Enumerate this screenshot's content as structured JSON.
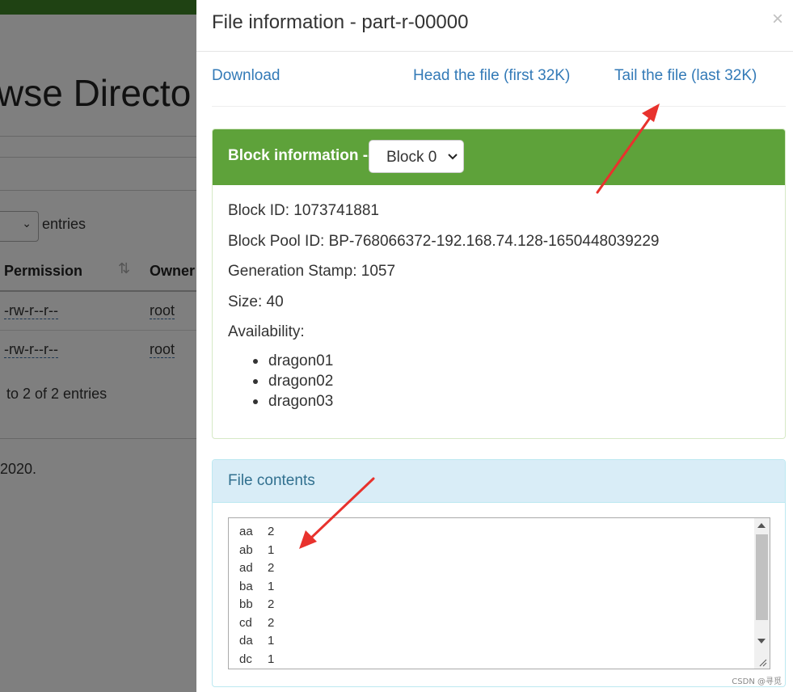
{
  "background": {
    "page_title_fragment": "wse Directo",
    "entries_label": "entries",
    "columns": [
      "Permission",
      "Owner"
    ],
    "rows": [
      {
        "permission": "-rw-r--r--",
        "owner": "root"
      },
      {
        "permission": "-rw-r--r--",
        "owner": "root"
      }
    ],
    "table_info": "to 2 of 2 entries",
    "footer_fragment": "2020."
  },
  "modal": {
    "title": "File information - part-r-00000",
    "close_glyph": "×",
    "links": {
      "download": "Download",
      "head": "Head the file (first 32K)",
      "tail": "Tail the file (last 32K)"
    },
    "block_panel": {
      "title": "Block information --",
      "selected_block": "Block 0",
      "block_id": "Block ID: 1073741881",
      "block_pool_id": "Block Pool ID: BP-768066372-192.168.74.128-1650448039229",
      "generation_stamp": "Generation Stamp: 1057",
      "size": "Size: 40",
      "availability_label": "Availability:",
      "availability": [
        "dragon01",
        "dragon02",
        "dragon03"
      ]
    },
    "contents_panel": {
      "title": "File contents",
      "lines": [
        {
          "key": "aa",
          "count": "2"
        },
        {
          "key": "ab",
          "count": "1"
        },
        {
          "key": "ad",
          "count": "2"
        },
        {
          "key": "ba",
          "count": "1"
        },
        {
          "key": "bb",
          "count": "2"
        },
        {
          "key": "cd",
          "count": "2"
        },
        {
          "key": "da",
          "count": "1"
        },
        {
          "key": "dc",
          "count": "1"
        }
      ]
    }
  },
  "watermark": "CSDN @寻觅",
  "colors": {
    "block_header_bg": "#5ea23a",
    "contents_header_bg": "#d9edf7",
    "link": "#337ab7",
    "annotation_arrow": "#e8322d"
  }
}
